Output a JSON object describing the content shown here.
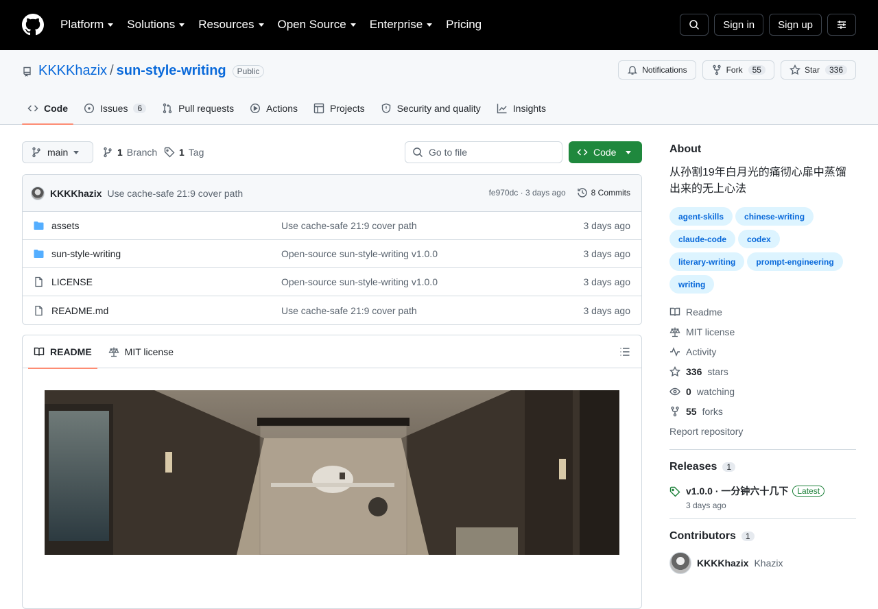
{
  "header": {
    "nav": [
      "Platform",
      "Solutions",
      "Resources",
      "Open Source",
      "Enterprise",
      "Pricing"
    ],
    "sign_in": "Sign in",
    "sign_up": "Sign up"
  },
  "repo": {
    "owner": "KKKKhazix",
    "separator": "/",
    "name": "sun-style-writing",
    "visibility": "Public",
    "notifications": "Notifications",
    "fork_label": "Fork",
    "fork_count": "55",
    "star_label": "Star",
    "star_count": "336"
  },
  "tabs": [
    {
      "label": "Code",
      "active": true
    },
    {
      "label": "Issues",
      "count": "6"
    },
    {
      "label": "Pull requests"
    },
    {
      "label": "Actions"
    },
    {
      "label": "Projects"
    },
    {
      "label": "Security and quality"
    },
    {
      "label": "Insights"
    }
  ],
  "toolbar": {
    "branch": "main",
    "branch_count": "1",
    "branch_label": "Branch",
    "tag_count": "1",
    "tag_label": "Tag",
    "goto_placeholder": "Go to file",
    "code_button": "Code"
  },
  "commit": {
    "author": "KKKKhazix",
    "message": "Use cache-safe 21:9 cover path",
    "sha_time": "fe970dc · 3 days ago",
    "commits": "8 Commits"
  },
  "files": [
    {
      "name": "assets",
      "type": "folder",
      "message": "Use cache-safe 21:9 cover path",
      "date": "3 days ago"
    },
    {
      "name": "sun-style-writing",
      "type": "folder",
      "message": "Open-source sun-style-writing v1.0.0",
      "date": "3 days ago"
    },
    {
      "name": "LICENSE",
      "type": "file",
      "message": "Open-source sun-style-writing v1.0.0",
      "date": "3 days ago"
    },
    {
      "name": "README.md",
      "type": "file",
      "message": "Use cache-safe 21:9 cover path",
      "date": "3 days ago"
    }
  ],
  "readme": {
    "tab_readme": "README",
    "tab_license": "MIT license"
  },
  "about": {
    "heading": "About",
    "description": "从孙割19年白月光的痛彻心扉中蒸馏出来的无上心法",
    "topics": [
      "agent-skills",
      "chinese-writing",
      "claude-code",
      "codex",
      "literary-writing",
      "prompt-engineering",
      "writing"
    ],
    "readme": "Readme",
    "license": "MIT license",
    "activity": "Activity",
    "stars_count": "336",
    "stars_label": "stars",
    "watching_count": "0",
    "watching_label": "watching",
    "forks_count": "55",
    "forks_label": "forks",
    "report": "Report repository"
  },
  "releases": {
    "heading": "Releases",
    "count": "1",
    "title": "v1.0.0 · 一分钟六十几下",
    "latest": "Latest",
    "date": "3 days ago"
  },
  "contributors": {
    "heading": "Contributors",
    "count": "1",
    "login": "KKKKhazix",
    "name": "Khazix"
  }
}
